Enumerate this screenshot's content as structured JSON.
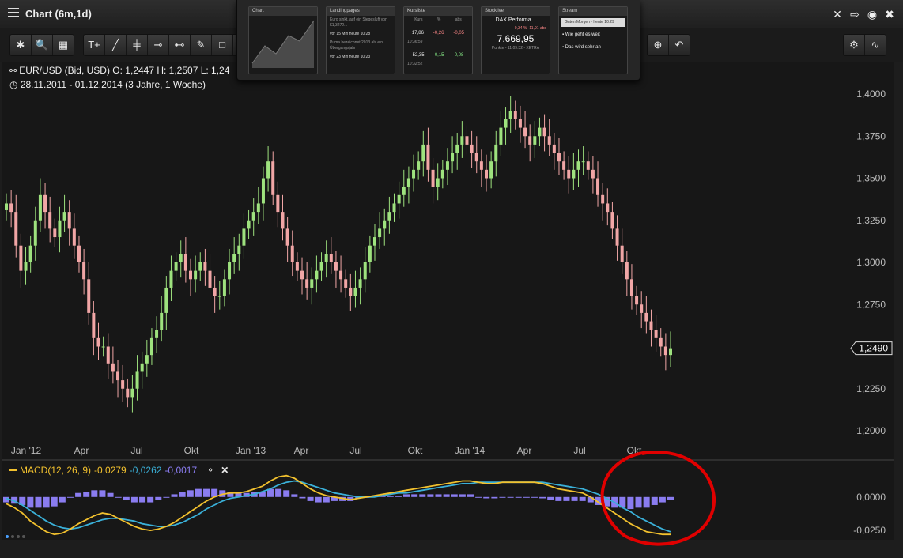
{
  "window": {
    "title": "Chart (6m,1d)"
  },
  "toolbar": {
    "left_group": [
      "✱",
      "🔍",
      "▦"
    ],
    "draw_group": [
      "T+",
      "╱",
      "╪",
      "⊸",
      "⊷",
      "✎",
      "□",
      "╳"
    ],
    "right_group": [
      "⊕",
      "↶"
    ],
    "far_right": [
      "⚙",
      "∿"
    ]
  },
  "widgets": [
    {
      "title": "Chart"
    },
    {
      "title": "Landingpages",
      "lines": [
        "Euro sinkt, auf ein Siegesluft von $1,3272...",
        "vor 15 Min heute 10:28",
        "Puma bezeichnet 2013 als ein Übergangsjahr",
        "vor 23 Min heute 10:23"
      ]
    },
    {
      "title": "Kursliste",
      "headers": [
        "Kurs",
        "%",
        "abs"
      ],
      "rows": [
        [
          "17,86",
          "-0,26",
          "-0,05",
          "10:36:59"
        ],
        [
          "52,35",
          "0,15",
          "0,08",
          "10:32:52"
        ]
      ]
    },
    {
      "title": "Stocklive",
      "name": "DAX Performa...",
      "pct": "-0,34 %",
      "abs": "-11,91 abs",
      "value": "7.669,95",
      "footer": "Punkte - 11:09:32 - XETRA"
    },
    {
      "title": "Stream",
      "greeting": "Guten Morgen",
      "greeting_time": "heute 10:29",
      "items": [
        "Wie geht es weit",
        "Das wird sehr an"
      ]
    }
  ],
  "info": {
    "line1": "EUR/USD (Bid, USD)  O: 1,2447  H: 1,2507  L: 1,24",
    "line2": "28.11.2011 - 01.12.2014 (3 Jahre, 1 Woche)"
  },
  "macd_legend": {
    "name": "MACD(12, 26, 9)",
    "macd": "-0,0279",
    "signal": "-0,0262",
    "hist": "-0,0017"
  },
  "colors": {
    "up": "#9ee27e",
    "down": "#f1a6a6",
    "macd": "#f2c12e",
    "signal": "#3ab0d8",
    "hist": "#8a7cf0",
    "annotation": "#e00000"
  },
  "chart_data": [
    {
      "type": "candlestick",
      "x_labels": [
        "Jan '12",
        "Apr",
        "Jul",
        "Okt",
        "Jan '13",
        "Apr",
        "Jul",
        "Okt",
        "Jan '14",
        "Apr",
        "Jul",
        "Okt"
      ],
      "y_ticks": [
        "1,4000",
        "1,3750",
        "1,3500",
        "1,3250",
        "1,3000",
        "1,2750",
        "1,2500",
        "1,2250",
        "1,2000"
      ],
      "ylim": [
        1.2,
        1.4
      ],
      "last_value": "1,2490",
      "closes": [
        1.335,
        1.33,
        1.31,
        1.295,
        1.3,
        1.31,
        1.325,
        1.34,
        1.33,
        1.32,
        1.315,
        1.325,
        1.33,
        1.32,
        1.31,
        1.3,
        1.29,
        1.27,
        1.255,
        1.25,
        1.25,
        1.24,
        1.235,
        1.23,
        1.225,
        1.22,
        1.225,
        1.235,
        1.24,
        1.245,
        1.255,
        1.26,
        1.27,
        1.285,
        1.295,
        1.3,
        1.305,
        1.295,
        1.29,
        1.295,
        1.3,
        1.295,
        1.285,
        1.28,
        1.28,
        1.29,
        1.3,
        1.305,
        1.31,
        1.32,
        1.325,
        1.33,
        1.335,
        1.35,
        1.36,
        1.34,
        1.33,
        1.32,
        1.31,
        1.3,
        1.295,
        1.29,
        1.285,
        1.29,
        1.295,
        1.3,
        1.305,
        1.3,
        1.295,
        1.29,
        1.285,
        1.28,
        1.285,
        1.29,
        1.3,
        1.31,
        1.315,
        1.32,
        1.325,
        1.33,
        1.335,
        1.34,
        1.345,
        1.35,
        1.355,
        1.36,
        1.37,
        1.355,
        1.345,
        1.35,
        1.355,
        1.36,
        1.365,
        1.37,
        1.375,
        1.37,
        1.365,
        1.36,
        1.355,
        1.35,
        1.36,
        1.37,
        1.38,
        1.385,
        1.39,
        1.385,
        1.38,
        1.375,
        1.37,
        1.375,
        1.38,
        1.375,
        1.37,
        1.365,
        1.36,
        1.355,
        1.35,
        1.355,
        1.36,
        1.36,
        1.355,
        1.35,
        1.34,
        1.335,
        1.33,
        1.32,
        1.31,
        1.3,
        1.29,
        1.28,
        1.275,
        1.27,
        1.265,
        1.26,
        1.255,
        1.25,
        1.245,
        1.249
      ]
    },
    {
      "type": "line",
      "name": "MACD(12, 26, 9)",
      "y_ticks": [
        "0,0000",
        "-0,0250"
      ],
      "ylim": [
        -0.032,
        0.017
      ],
      "macd": [
        -0.005,
        -0.008,
        -0.012,
        -0.018,
        -0.022,
        -0.026,
        -0.028,
        -0.027,
        -0.024,
        -0.02,
        -0.017,
        -0.014,
        -0.012,
        -0.013,
        -0.016,
        -0.019,
        -0.022,
        -0.024,
        -0.025,
        -0.024,
        -0.022,
        -0.019,
        -0.015,
        -0.011,
        -0.007,
        -0.003,
        0.0,
        0.002,
        0.003,
        0.003,
        0.004,
        0.006,
        0.008,
        0.012,
        0.015,
        0.016,
        0.014,
        0.01,
        0.006,
        0.003,
        0.001,
        0.0,
        -0.001,
        -0.002,
        -0.001,
        0.0,
        0.001,
        0.002,
        0.003,
        0.004,
        0.005,
        0.006,
        0.007,
        0.008,
        0.009,
        0.01,
        0.011,
        0.012,
        0.012,
        0.011,
        0.01,
        0.01,
        0.011,
        0.011,
        0.011,
        0.011,
        0.011,
        0.01,
        0.008,
        0.006,
        0.005,
        0.004,
        0.003,
        0.0,
        -0.004,
        -0.008,
        -0.012,
        -0.016,
        -0.02,
        -0.023,
        -0.026,
        -0.027,
        -0.028,
        -0.028
      ],
      "signal": [
        -0.001,
        -0.003,
        -0.006,
        -0.01,
        -0.014,
        -0.018,
        -0.021,
        -0.023,
        -0.024,
        -0.023,
        -0.021,
        -0.019,
        -0.017,
        -0.016,
        -0.016,
        -0.017,
        -0.018,
        -0.02,
        -0.021,
        -0.022,
        -0.022,
        -0.021,
        -0.019,
        -0.016,
        -0.013,
        -0.009,
        -0.006,
        -0.003,
        -0.001,
        0.0,
        0.001,
        0.002,
        0.004,
        0.006,
        0.009,
        0.011,
        0.012,
        0.011,
        0.009,
        0.007,
        0.005,
        0.003,
        0.002,
        0.001,
        0.0,
        0.0,
        0.0,
        0.001,
        0.002,
        0.003,
        0.003,
        0.004,
        0.005,
        0.006,
        0.007,
        0.008,
        0.009,
        0.01,
        0.01,
        0.011,
        0.011,
        0.011,
        0.011,
        0.011,
        0.011,
        0.011,
        0.011,
        0.011,
        0.01,
        0.009,
        0.008,
        0.007,
        0.006,
        0.004,
        0.002,
        -0.001,
        -0.004,
        -0.008,
        -0.011,
        -0.015,
        -0.018,
        -0.021,
        -0.024,
        -0.026
      ]
    }
  ]
}
